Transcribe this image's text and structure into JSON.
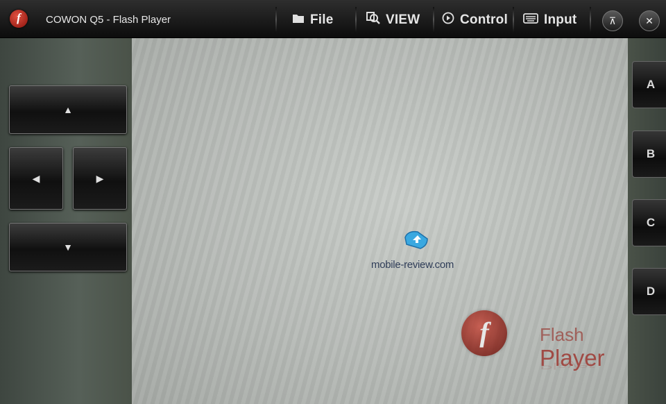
{
  "titlebar": {
    "app_icon": "flash-icon",
    "title": "COWON Q5 - Flash Player",
    "menus": [
      {
        "label": "File",
        "icon": "folder-icon"
      },
      {
        "label": "VIEW",
        "icon": "zoom-icon"
      },
      {
        "label": "Control",
        "icon": "play-circle-icon"
      },
      {
        "label": "Input",
        "icon": "keyboard-icon"
      }
    ],
    "buttons": [
      "minimize-icon",
      "close-icon"
    ]
  },
  "dpad": {
    "up": "up-arrow-icon",
    "left": "left-arrow-icon",
    "right": "right-arrow-icon",
    "down": "down-arrow-icon"
  },
  "side_buttons": [
    "A",
    "B",
    "C",
    "D"
  ],
  "stage": {
    "site": "mobile-review.com",
    "flash_word1": "Flash",
    "flash_word2": "Player"
  },
  "colors": {
    "accent": "#c84a3c",
    "titlebar": "#1a1a1a",
    "stage": "#b8bcb8"
  }
}
